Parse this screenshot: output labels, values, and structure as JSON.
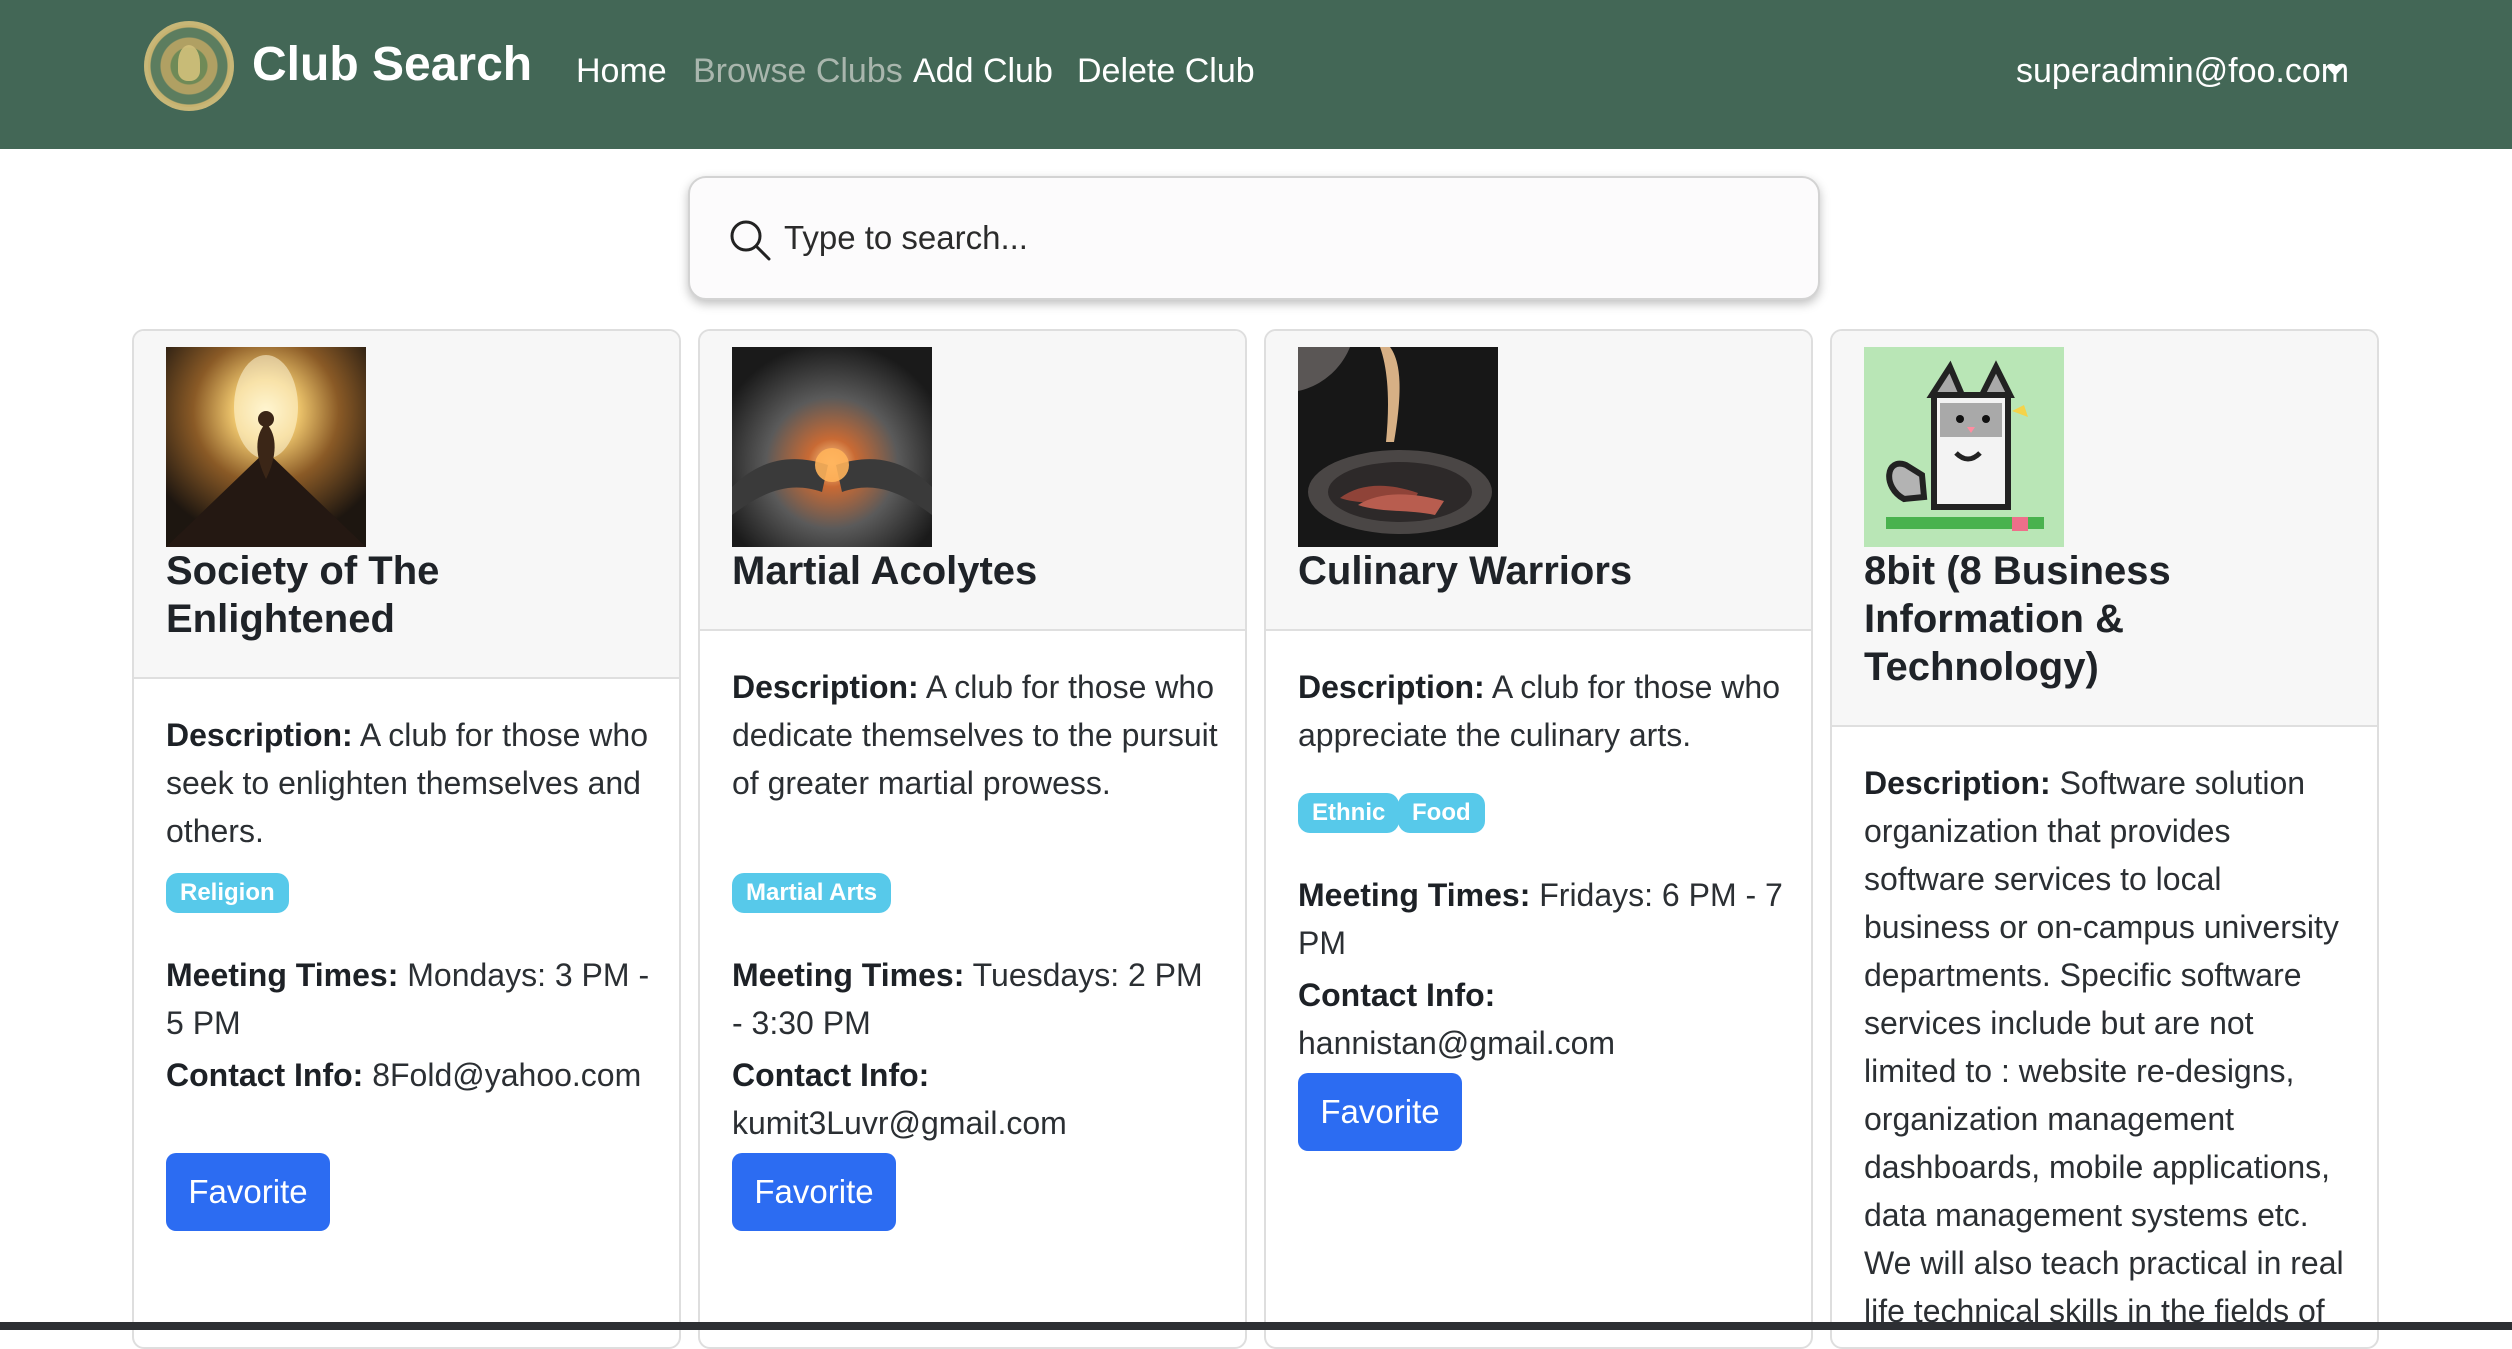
{
  "navbar": {
    "brand": "Club Search",
    "links": [
      {
        "label": "Home"
      },
      {
        "label": "Browse Clubs"
      },
      {
        "label": "Add Club"
      },
      {
        "label": "Delete Club"
      }
    ],
    "user": "superadmin@foo.com"
  },
  "search": {
    "placeholder": "Type to search..."
  },
  "labels": {
    "description": "Description:",
    "meeting": "Meeting Times:",
    "contact": "Contact Info:",
    "favorite": "Favorite"
  },
  "cards": [
    {
      "title": "Society of The Enlightened",
      "description": "A club for those who seek to enlighten themselves and others.",
      "tags": [
        "Religion"
      ],
      "meeting": "Mondays: 3 PM - 5 PM",
      "contact": "8Fold@yahoo.com"
    },
    {
      "title": "Martial Acolytes",
      "description": "A club for those who dedicate themselves to the pursuit of greater martial prowess.",
      "tags": [
        "Martial Arts"
      ],
      "meeting": "Tuesdays: 2 PM - 3:30 PM",
      "contact": "kumit3Luvr@gmail.com"
    },
    {
      "title": "Culinary Warriors",
      "description": "A club for those who appreciate the culinary arts.",
      "tags": [
        "Ethnic",
        "Food"
      ],
      "meeting": "Fridays: 6 PM - 7 PM",
      "contact": "hannistan@gmail.com"
    },
    {
      "title": "8bit (8 Business Information & Technology)",
      "description": "Software solution organization that provides software services to local business or on-campus university departments. Specific software services include but are not limited to : website re-designs, organization management dashboards, mobile applications, data management systems etc. We will also teach practical in real life technical skills in the fields of"
    }
  ],
  "colors": {
    "navbar": "#436756",
    "tag": "#57c9ea",
    "button": "#2c6cf2"
  }
}
